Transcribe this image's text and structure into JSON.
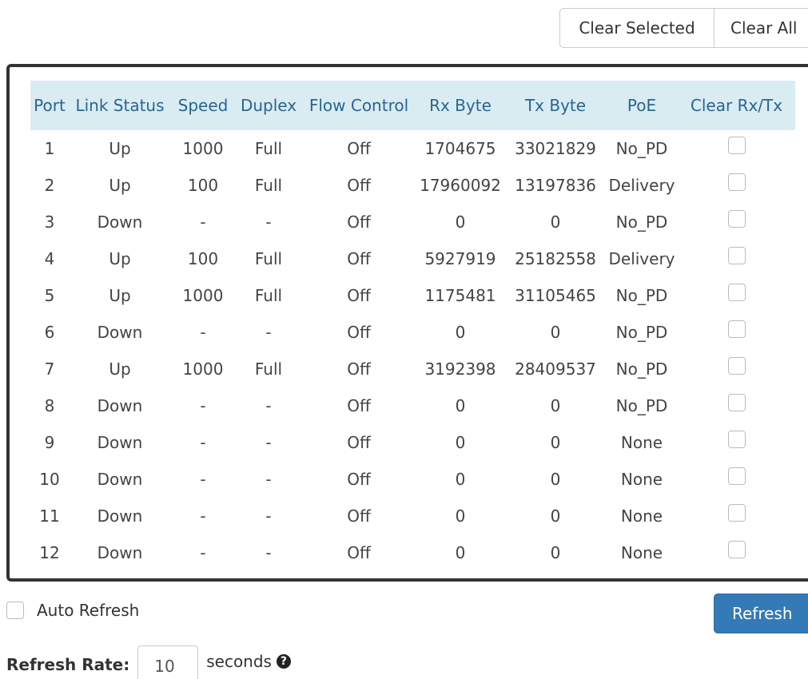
{
  "toolbar": {
    "clear_selected": "Clear Selected",
    "clear_all": "Clear All"
  },
  "table": {
    "columns": [
      "Port",
      "Link Status",
      "Speed",
      "Duplex",
      "Flow Control",
      "Rx Byte",
      "Tx Byte",
      "PoE",
      "Clear Rx/Tx"
    ],
    "rows": [
      {
        "port": "1",
        "link": "Up",
        "speed": "1000",
        "duplex": "Full",
        "flow": "Off",
        "rx": "1704675",
        "tx": "33021829",
        "poe": "No_PD",
        "clear": false
      },
      {
        "port": "2",
        "link": "Up",
        "speed": "100",
        "duplex": "Full",
        "flow": "Off",
        "rx": "17960092",
        "tx": "13197836",
        "poe": "Delivery",
        "clear": false
      },
      {
        "port": "3",
        "link": "Down",
        "speed": "-",
        "duplex": "-",
        "flow": "Off",
        "rx": "0",
        "tx": "0",
        "poe": "No_PD",
        "clear": false
      },
      {
        "port": "4",
        "link": "Up",
        "speed": "100",
        "duplex": "Full",
        "flow": "Off",
        "rx": "5927919",
        "tx": "25182558",
        "poe": "Delivery",
        "clear": false
      },
      {
        "port": "5",
        "link": "Up",
        "speed": "1000",
        "duplex": "Full",
        "flow": "Off",
        "rx": "1175481",
        "tx": "31105465",
        "poe": "No_PD",
        "clear": false
      },
      {
        "port": "6",
        "link": "Down",
        "speed": "-",
        "duplex": "-",
        "flow": "Off",
        "rx": "0",
        "tx": "0",
        "poe": "No_PD",
        "clear": false
      },
      {
        "port": "7",
        "link": "Up",
        "speed": "1000",
        "duplex": "Full",
        "flow": "Off",
        "rx": "3192398",
        "tx": "28409537",
        "poe": "No_PD",
        "clear": false
      },
      {
        "port": "8",
        "link": "Down",
        "speed": "-",
        "duplex": "-",
        "flow": "Off",
        "rx": "0",
        "tx": "0",
        "poe": "No_PD",
        "clear": false
      },
      {
        "port": "9",
        "link": "Down",
        "speed": "-",
        "duplex": "-",
        "flow": "Off",
        "rx": "0",
        "tx": "0",
        "poe": "None",
        "clear": false
      },
      {
        "port": "10",
        "link": "Down",
        "speed": "-",
        "duplex": "-",
        "flow": "Off",
        "rx": "0",
        "tx": "0",
        "poe": "None",
        "clear": false
      },
      {
        "port": "11",
        "link": "Down",
        "speed": "-",
        "duplex": "-",
        "flow": "Off",
        "rx": "0",
        "tx": "0",
        "poe": "None",
        "clear": false
      },
      {
        "port": "12",
        "link": "Down",
        "speed": "-",
        "duplex": "-",
        "flow": "Off",
        "rx": "0",
        "tx": "0",
        "poe": "None",
        "clear": false
      }
    ]
  },
  "footer": {
    "auto_refresh_label": "Auto Refresh",
    "auto_refresh_checked": false,
    "refresh_button": "Refresh",
    "refresh_rate_label": "Refresh Rate:",
    "refresh_rate_value": "10",
    "refresh_rate_suffix": "seconds",
    "help_icon": "question-circle-icon"
  },
  "colors": {
    "header_bg": "#d9ecf2",
    "header_text": "#2a6491",
    "primary_button": "#337ab7"
  }
}
